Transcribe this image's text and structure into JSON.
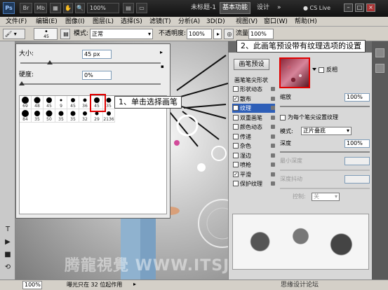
{
  "titlebar": {
    "app_logo": "Ps",
    "zoom": "100%",
    "doc_title": "未标题-1",
    "workspace_active": "基本功能",
    "workspace_design": "设计",
    "cslive": "CS Live"
  },
  "menu": [
    "文件(F)",
    "编辑(E)",
    "图像(I)",
    "图层(L)",
    "选择(S)",
    "滤镜(T)",
    "分析(A)",
    "3D(D)",
    "视图(V)",
    "窗口(W)",
    "帮助(H)"
  ],
  "options": {
    "brush_size": "45",
    "mode_label": "模式:",
    "mode_value": "正常",
    "opacity_label": "不透明度:",
    "opacity_value": "100%",
    "flow_label": "流量:",
    "flow_value": "100%"
  },
  "brush_picker": {
    "size_label": "大小:",
    "size_value": "45 px",
    "hardness_label": "硬度:",
    "hardness_value": "0%",
    "brushes": [
      {
        "size": "69",
        "dot": 10
      },
      {
        "size": "48",
        "dot": 9
      },
      {
        "size": "45",
        "dot": 8
      },
      {
        "size": "9",
        "dot": 3
      },
      {
        "size": "45",
        "dot": 6
      },
      {
        "size": "36",
        "dot": 5
      },
      {
        "size": "45",
        "dot": 8
      },
      {
        "size": "35",
        "dot": 7
      },
      {
        "size": "84",
        "dot": 10
      },
      {
        "size": "35",
        "dot": 8
      },
      {
        "size": "50",
        "dot": 9
      },
      {
        "size": "35",
        "dot": 7
      },
      {
        "size": "35",
        "dot": 7
      },
      {
        "size": "32",
        "dot": 6
      },
      {
        "size": "29",
        "dot": 5
      },
      {
        "size": "2136",
        "dot": 6
      }
    ]
  },
  "callouts": {
    "step1": "1、单击选择画笔",
    "step2": "2、此画笔预设带有纹理选项的设置"
  },
  "brush_panel": {
    "preset_button": "画笔预设",
    "tip_shape": "画笔笔尖形状",
    "items": [
      {
        "label": "形状动态",
        "checked": false
      },
      {
        "label": "散布",
        "checked": true
      },
      {
        "label": "纹理",
        "checked": true,
        "active": true
      },
      {
        "label": "双重画笔",
        "checked": false
      },
      {
        "label": "颜色动态",
        "checked": false
      },
      {
        "label": "传递",
        "checked": false
      },
      {
        "label": "杂色",
        "checked": false
      },
      {
        "label": "湿边",
        "checked": false
      },
      {
        "label": "喷枪",
        "checked": false
      },
      {
        "label": "平滑",
        "checked": true
      },
      {
        "label": "保护纹理",
        "checked": false
      }
    ],
    "invert_label": "反相",
    "scale_label": "缩放",
    "scale_value": "100%",
    "each_tip_label": "为每个笔尖设置纹理",
    "mode_label": "模式:",
    "mode_value": "正片叠底",
    "depth_label": "深度",
    "depth_value": "100%",
    "min_depth_label": "最小深度",
    "depth_jitter_label": "深度抖动",
    "control_label": "控制:",
    "control_value": "关"
  },
  "status": {
    "zoom": "100%",
    "text": "曝光只在 32 位起作用",
    "site": "思缘设计论坛"
  }
}
